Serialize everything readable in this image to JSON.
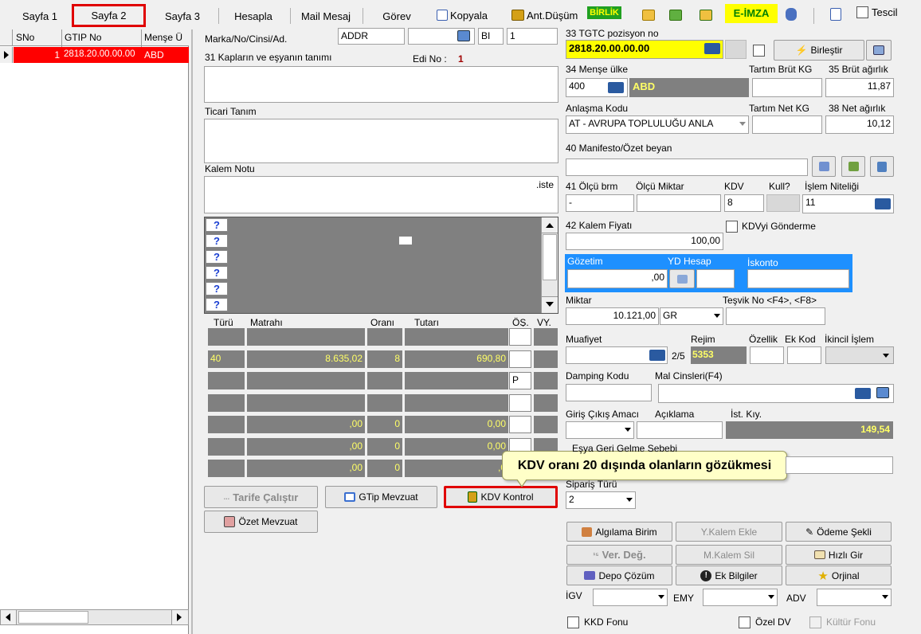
{
  "tabs": [
    {
      "label": "Sayfa 1"
    },
    {
      "label": "Sayfa 2"
    },
    {
      "label": "Sayfa 3"
    },
    {
      "label": "Hesapla"
    },
    {
      "label": "Mail Mesaj"
    },
    {
      "label": "Görev"
    }
  ],
  "toolbar": {
    "kopyala": "Kopyala",
    "ant_dusum": "Ant.Düşüm",
    "birlik": "BİRLİK",
    "e_imza": "E-İMZA",
    "tescil": "Tescil"
  },
  "left_grid": {
    "headers": [
      "SNo",
      "GTIP No",
      "Menşe Ü"
    ],
    "rows": [
      {
        "sno": "1",
        "gtip": "2818.20.00.00.00",
        "mense": "ABD"
      }
    ]
  },
  "form": {
    "marka_label": "Marka/No/Cinsi/Ad.",
    "marka_value": "ADDR",
    "bi_value": "BI",
    "count_value": "1",
    "kaplar_label": "31 Kapların ve eşyanın tanımı",
    "edi_label": "Edi No :",
    "edi_value": "1",
    "ticari_label": "Ticari Tanım",
    "kalem_notu_label": "Kalem Notu",
    "kalem_notu_value": ".iste"
  },
  "tax_grid": {
    "headers": [
      "Türü",
      "Matrahı",
      "Oranı",
      "Tutarı",
      "ÖŞ.",
      "VY."
    ],
    "rows": [
      {
        "turu": "",
        "matrah": "",
        "oran": "",
        "tutar": "",
        "os": ""
      },
      {
        "turu": "40",
        "matrah": "8.635,02",
        "oran": "8",
        "tutar": "690,80",
        "os": ""
      },
      {
        "turu": "",
        "matrah": "",
        "oran": "",
        "tutar": "",
        "os": "P"
      },
      {
        "turu": "",
        "matrah": "",
        "oran": "",
        "tutar": "",
        "os": ""
      },
      {
        "turu": "",
        "matrah": ",00",
        "oran": "0",
        "tutar": "0,00",
        "os": ""
      },
      {
        "turu": "",
        "matrah": ",00",
        "oran": "0",
        "tutar": "0,00",
        "os": ""
      },
      {
        "turu": "",
        "matrah": ",00",
        "oran": "0",
        "tutar": ",0",
        "os": ""
      }
    ]
  },
  "buttons": {
    "tarife": "Tarife Çalıştır",
    "gtip_mevzuat": "GTip Mevzuat",
    "kdv_kontrol": "KDV Kontrol",
    "ozet_mevzuat": "Özet Mevzuat",
    "birlestir": "Birleştir",
    "algilama": "Algılama Birim",
    "y_kalem_ekle": "Y.Kalem Ekle",
    "odeme_sekli": "Ödeme Şekli",
    "ver_deg": "Ver. Değ.",
    "m_kalem_sil": "M.Kalem Sil",
    "hizli_gir": "Hızlı Gir",
    "depo_cozum": "Depo Çözüm",
    "ek_bilgiler": "Ek Bilgiler",
    "orjinal": "Orjinal"
  },
  "tooltip": "KDV oranı 20 dışında olanların gözükmesi",
  "right": {
    "tgtc_label": "33 TGTC pozisyon no",
    "tgtc_value": "2818.20.00.00.00",
    "mense_label": "34 Menşe ülke",
    "mense_code": "400",
    "mense_name": "ABD",
    "tartim_brut_label": "Tartım Brüt KG",
    "brut_label": "35 Brüt ağırlık",
    "brut_value": "11,87",
    "anlasma_label": "Anlaşma Kodu",
    "anlasma_value": "AT - AVRUPA TOPLULUĞU ANLA",
    "tartim_net_label": "Tartım Net KG",
    "net_label": "38 Net ağırlık",
    "net_value": "10,12",
    "manifesto_label": "40 Manifesto/Özet beyan",
    "olcu_brm_label": "41 Ölçü brm",
    "olcu_brm_value": "-",
    "olcu_miktar_label": "Ölçü Miktar",
    "kdv_label": "KDV",
    "kdv_value": "8",
    "kull_label": "Kull?",
    "islem_label": "İşlem Niteliği",
    "islem_value": "11",
    "kalem_fiyat_label": "42 Kalem Fiyatı",
    "kalem_fiyat_value": "100,00",
    "kdvyi_label": "KDVyi Gönderme",
    "gozetim_label": "Gözetim",
    "gozetim_value": ",00",
    "yd_hesap_label": "YD Hesap",
    "iskonto_label": "İskonto",
    "miktar_label": "Miktar",
    "miktar_value": "10.121,00",
    "miktar_unit": "GR",
    "tesvik_label": "Teşvik No <F4>, <F8>",
    "muafiyet_label": "Muafiyet",
    "muafiyet_suffix": "2/5",
    "rejim_label": "Rejim",
    "rejim_value": "5353",
    "ozellik_label": "Özellik",
    "ek_kod_label": "Ek Kod",
    "ikincil_label": "İkincil İşlem",
    "damping_label": "Damping Kodu",
    "mal_cinsleri_label": "Mal Cinsleri(F4)",
    "giris_label": "Giriş Çıkış Amacı",
    "aciklama_label": "Açıklama",
    "ist_kiy_label": "İst. Kıy.",
    "ist_kiy_value": "149,54",
    "esya_label": "Eşya Geri Gelme Sebebi",
    "siparis_label": "Sipariş Türü",
    "siparis_value": "2",
    "igv_label": "İGV",
    "emy_label": "EMY",
    "adv_label": "ADV",
    "kkd_label": "KKD Fonu",
    "ozel_dv_label": "Özel DV",
    "kultur_label": "Kültür Fonu"
  },
  "colors": {
    "selected_row": "#ff0000",
    "highlight_yellow": "#ffff00",
    "grid_gray": "#808080",
    "gozetim_blue": "#1e90ff",
    "callout_red": "#ff0000"
  }
}
